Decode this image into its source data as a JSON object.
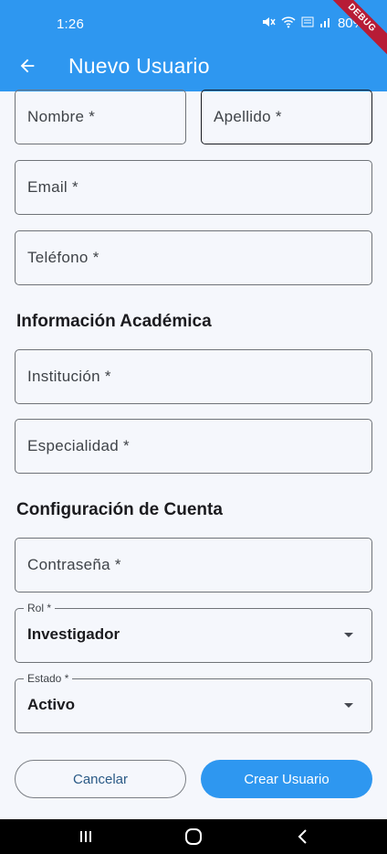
{
  "status_bar": {
    "time": "1:26",
    "battery": "80%",
    "debug_banner": "DEBUG"
  },
  "app_bar": {
    "title": "Nuevo Usuario",
    "back_icon": "arrow-left-icon"
  },
  "form": {
    "nombre_label": "Nombre *",
    "apellido_label": "Apellido *",
    "email_label": "Email *",
    "telefono_label": "Teléfono *",
    "section_academic": "Información Académica",
    "institucion_label": "Institución *",
    "especialidad_label": "Especialidad *",
    "section_account": "Configuración de Cuenta",
    "contrasena_label": "Contraseña *",
    "rol": {
      "label": "Rol *",
      "value": "Investigador"
    },
    "estado": {
      "label": "Estado *",
      "value": "Activo"
    }
  },
  "actions": {
    "cancel_label": "Cancelar",
    "create_label": "Crear Usuario"
  },
  "colors": {
    "primary": "#2e97f0",
    "background": "#f5f7fc",
    "debug": "#b71c36"
  }
}
